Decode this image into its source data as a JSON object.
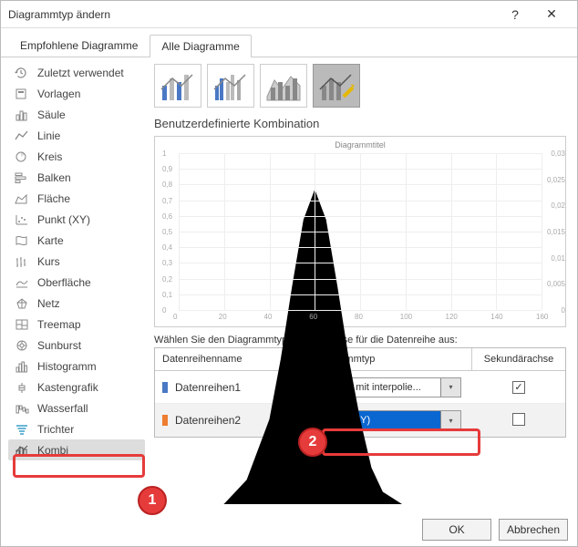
{
  "window": {
    "title": "Diagrammtyp ändern",
    "help_label": "?",
    "close_label": "✕"
  },
  "tabs": {
    "recommended": "Empfohlene Diagramme",
    "all": "Alle Diagramme"
  },
  "sidebar": {
    "items": [
      {
        "label": "Zuletzt verwendet"
      },
      {
        "label": "Vorlagen"
      },
      {
        "label": "Säule"
      },
      {
        "label": "Linie"
      },
      {
        "label": "Kreis"
      },
      {
        "label": "Balken"
      },
      {
        "label": "Fläche"
      },
      {
        "label": "Punkt (XY)"
      },
      {
        "label": "Karte"
      },
      {
        "label": "Kurs"
      },
      {
        "label": "Oberfläche"
      },
      {
        "label": "Netz"
      },
      {
        "label": "Treemap"
      },
      {
        "label": "Sunburst"
      },
      {
        "label": "Histogramm"
      },
      {
        "label": "Kastengrafik"
      },
      {
        "label": "Wasserfall"
      },
      {
        "label": "Trichter"
      },
      {
        "label": "Kombi"
      }
    ]
  },
  "preview": {
    "subtype_title": "Benutzerdefinierte Kombination",
    "chart_title": "Diagrammtitel"
  },
  "series": {
    "help_text": "Wählen Sie den Diagrammtyp und die Achse für die Datenreihe aus:",
    "headers": {
      "name": "Datenreihenname",
      "type": "Diagrammtyp",
      "axis": "Sekundärachse"
    },
    "rows": [
      {
        "name": "Datenreihen1",
        "color": "#4a78c4",
        "type": "Punkte mit interpolie...",
        "secondary": true
      },
      {
        "name": "Datenreihen2",
        "color": "#ed7d31",
        "type": "Punkt (XY)",
        "secondary": false
      }
    ]
  },
  "buttons": {
    "ok": "OK",
    "cancel": "Abbrechen"
  },
  "chart_data": {
    "type": "combo",
    "title": "Diagrammtitel",
    "x_ticks": [
      0,
      20,
      40,
      60,
      80,
      100,
      120,
      140,
      160
    ],
    "y_left_ticks": [
      0,
      0.1,
      0.2,
      0.3,
      0.4,
      0.5,
      0.6,
      0.7,
      0.8,
      0.9,
      1.0
    ],
    "y_right_ticks": [
      0,
      0.005,
      0.01,
      0.015,
      0.02,
      0.025,
      0.03
    ],
    "series": [
      {
        "name": "Datenreihen1",
        "style": "line-interpolated",
        "axis": "secondary",
        "x": [
          0,
          10,
          20,
          30,
          40,
          45,
          50,
          55,
          60,
          65,
          70,
          75,
          80,
          85,
          90,
          100,
          110,
          120,
          130,
          140
        ],
        "y": [
          0,
          0.0005,
          0.001,
          0.003,
          0.008,
          0.013,
          0.019,
          0.0245,
          0.027,
          0.0245,
          0.019,
          0.013,
          0.008,
          0.004,
          0.002,
          0.0008,
          0.0003,
          0.0001,
          5e-05,
          0
        ]
      },
      {
        "name": "Datenreihen2",
        "style": "scatter",
        "axis": "primary",
        "x": [
          20,
          30,
          40,
          50,
          60,
          70,
          80,
          90,
          100,
          130
        ],
        "y": [
          0,
          0,
          0,
          0,
          0,
          0,
          0,
          0,
          0,
          0
        ]
      }
    ]
  }
}
